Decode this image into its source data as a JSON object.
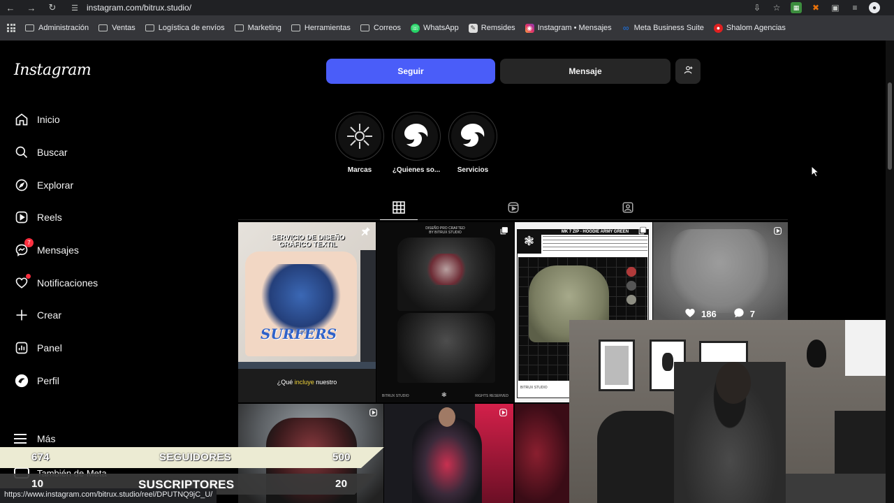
{
  "browser": {
    "url": "instagram.com/bitrux.studio/",
    "status_url": "https://www.instagram.com/bitrux.studio/reel/DPUTNQ9jC_U/"
  },
  "bookmarks": [
    {
      "label": "Administración",
      "kind": "folder"
    },
    {
      "label": "Ventas",
      "kind": "folder"
    },
    {
      "label": "Logística de envíos",
      "kind": "folder"
    },
    {
      "label": "Marketing",
      "kind": "folder"
    },
    {
      "label": "Herramientas",
      "kind": "folder"
    },
    {
      "label": "Correos",
      "kind": "folder"
    },
    {
      "label": "WhatsApp",
      "kind": "whatsapp"
    },
    {
      "label": "Remsides",
      "kind": "site"
    },
    {
      "label": "Instagram • Mensajes",
      "kind": "instagram"
    },
    {
      "label": "Meta Business Suite",
      "kind": "meta"
    },
    {
      "label": "Shalom Agencias",
      "kind": "shalom"
    }
  ],
  "app": {
    "logo": "Instagram"
  },
  "sidebar": {
    "items": [
      {
        "label": "Inicio",
        "icon": "home-icon"
      },
      {
        "label": "Buscar",
        "icon": "search-icon"
      },
      {
        "label": "Explorar",
        "icon": "compass-icon"
      },
      {
        "label": "Reels",
        "icon": "reels-icon"
      },
      {
        "label": "Mensajes",
        "icon": "messenger-icon",
        "badge": "7"
      },
      {
        "label": "Notificaciones",
        "icon": "heart-icon"
      },
      {
        "label": "Crear",
        "icon": "plus-icon"
      },
      {
        "label": "Panel",
        "icon": "dashboard-icon"
      },
      {
        "label": "Perfil",
        "icon": "profile-avatar-icon"
      }
    ],
    "more": "Más",
    "also_meta": "También de Meta"
  },
  "profile": {
    "follow_label": "Seguir",
    "message_label": "Mensaje",
    "highlights": [
      {
        "label": "Marcas"
      },
      {
        "label": "¿Quienes so..."
      },
      {
        "label": "Servicios"
      }
    ]
  },
  "posts": {
    "p1_title": "SERVICIO DE DISEÑO\nGRÁFICO TEXTIL",
    "p1_caption_a": "¿Qué ",
    "p1_caption_b": "incluye",
    "p1_caption_c": " nuestro",
    "p1_shirt_text": "SURFERS",
    "p2_header": "DISEÑO PRO CRAFTED\nBY BITRUX STUDIO",
    "p2_footer_left": "BITRUX STUDIO",
    "p2_footer_right": "RIGHTS RESERVED",
    "p3_title": "MK 7 ZIP - HOODIE ARMY GREEN",
    "p3_footer": "BITRUX STUDIO",
    "p4_likes": "186",
    "p4_comments": "7"
  },
  "overlay": {
    "followers_current": "674",
    "followers_label": "SEGUIDORES",
    "followers_goal": "500",
    "subs_current": "10",
    "subs_label": "SUSCRIPTORES",
    "subs_goal": "20"
  },
  "colors": {
    "follow_button": "#4a5df9",
    "badge": "#ff3040",
    "surface": "#262626"
  }
}
